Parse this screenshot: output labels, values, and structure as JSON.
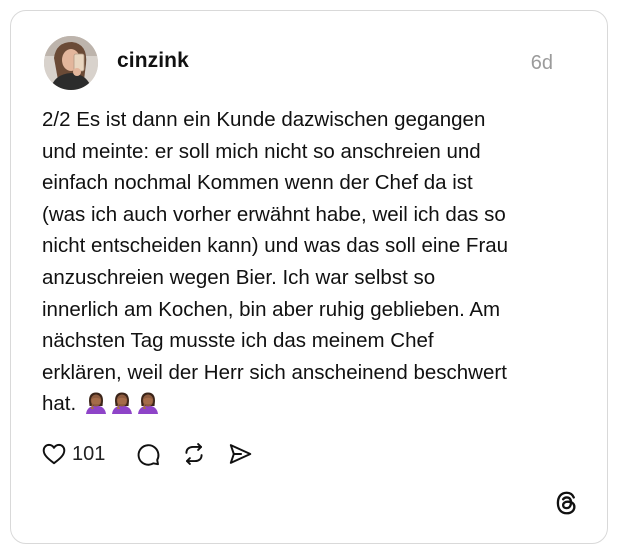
{
  "post": {
    "username": "cinzink",
    "time": "6d",
    "text": "2/2 Es ist dann ein Kunde dazwischen gegangen\nund meinte: er soll mich nicht so anschreien und\neinfach nochmal Kommen wenn der Chef da ist\n(was ich auch vorher erwähnt habe, weil ich das so\nnicht entscheiden kann) und was das soll eine Frau\nanzuschreien wegen Bier. Ich war selbst so\ninnerlich am Kochen, bin aber ruhig geblieben. Am\nnächsten Tag musste ich das meinem Chef\nerklären, weil der Herr sich anscheinend beschwert\nhat. ",
    "emoji_count": 3,
    "emoji_name": "face-palm-woman-emoji",
    "likes": "101"
  },
  "icons": {
    "like": "heart-icon",
    "comment": "comment-bubble-icon",
    "repost": "repost-icon",
    "share": "send-icon",
    "brand": "threads-logo"
  },
  "colors": {
    "text": "#111111",
    "muted": "#9b9b9b",
    "border": "#d9d9d9",
    "emoji_skin": "#8d5b3f",
    "emoji_shirt": "#8e44c8"
  }
}
